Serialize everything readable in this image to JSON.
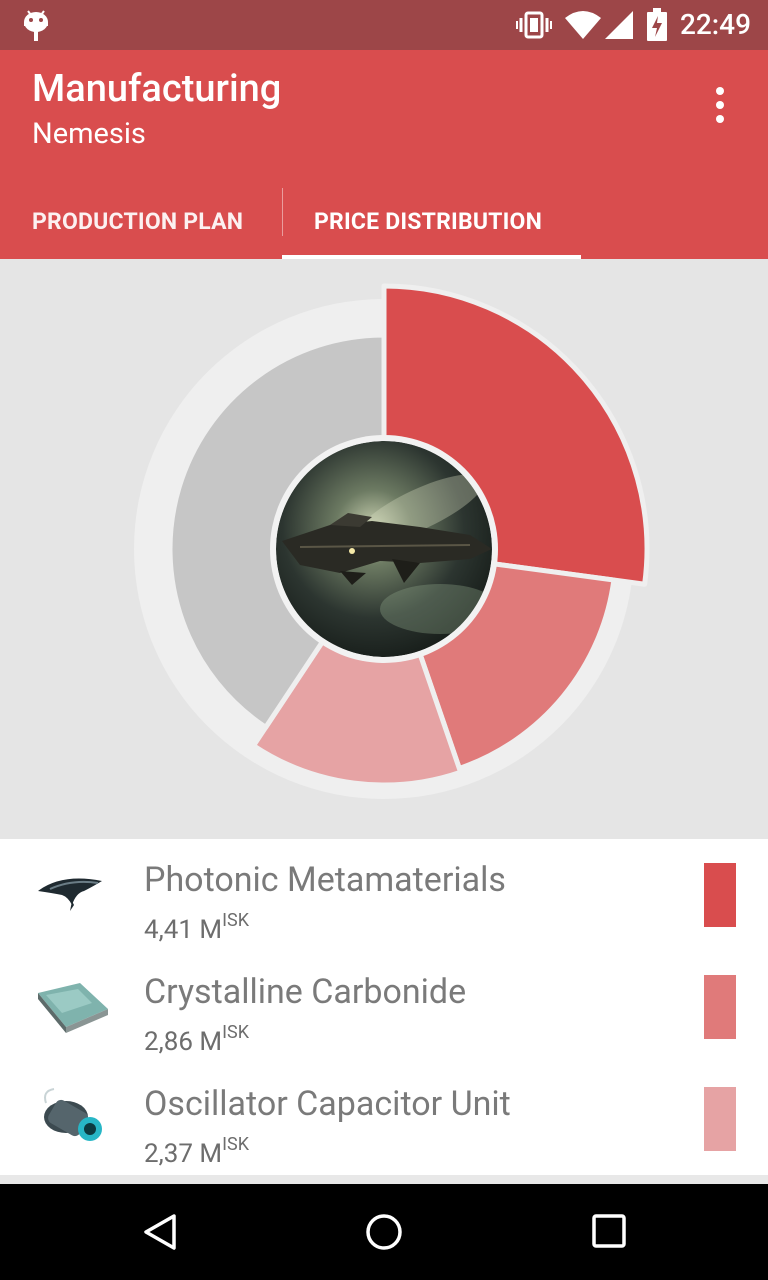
{
  "status_bar": {
    "time": "22:49",
    "icons": [
      "android-icon",
      "vibrate-icon",
      "wifi-icon",
      "signal-icon",
      "battery-charging-icon"
    ]
  },
  "app_bar": {
    "title": "Manufacturing",
    "subtitle": "Nemesis",
    "overflow_icon": "more-vert-icon",
    "tabs": [
      {
        "label": "PRODUCTION PLAN",
        "selected": false
      },
      {
        "label": "PRICE DISTRIBUTION",
        "selected": true
      }
    ]
  },
  "chart_data": {
    "type": "pie",
    "style": "donut",
    "center_image": "nemesis-ship-image",
    "slices": [
      {
        "label": "Photonic Metamaterials",
        "value": 4.41,
        "color": "#d94d4e"
      },
      {
        "label": "Crystalline Carbonide",
        "value": 2.86,
        "color": "#e07a7a"
      },
      {
        "label": "Oscillator Capacitor Unit",
        "value": 2.37,
        "color": "#e6a3a4"
      },
      {
        "label": "",
        "value": 6.61,
        "color": "#c6c6c6"
      }
    ]
  },
  "materials": [
    {
      "name": "Photonic Metamaterials",
      "price": "4,41 M",
      "unit": "ISK",
      "color": "#d94d4e",
      "icon": "photonic-metamaterials-icon"
    },
    {
      "name": "Crystalline Carbonide",
      "price": "2,86 M",
      "unit": "ISK",
      "color": "#e07a7a",
      "icon": "crystalline-carbonide-icon"
    },
    {
      "name": "Oscillator Capacitor Unit",
      "price": "2,37 M",
      "unit": "ISK",
      "color": "#e6a3a4",
      "icon": "oscillator-capacitor-unit-icon"
    }
  ],
  "nav_bar": {
    "buttons": [
      "back-icon",
      "home-icon",
      "recents-icon"
    ]
  }
}
